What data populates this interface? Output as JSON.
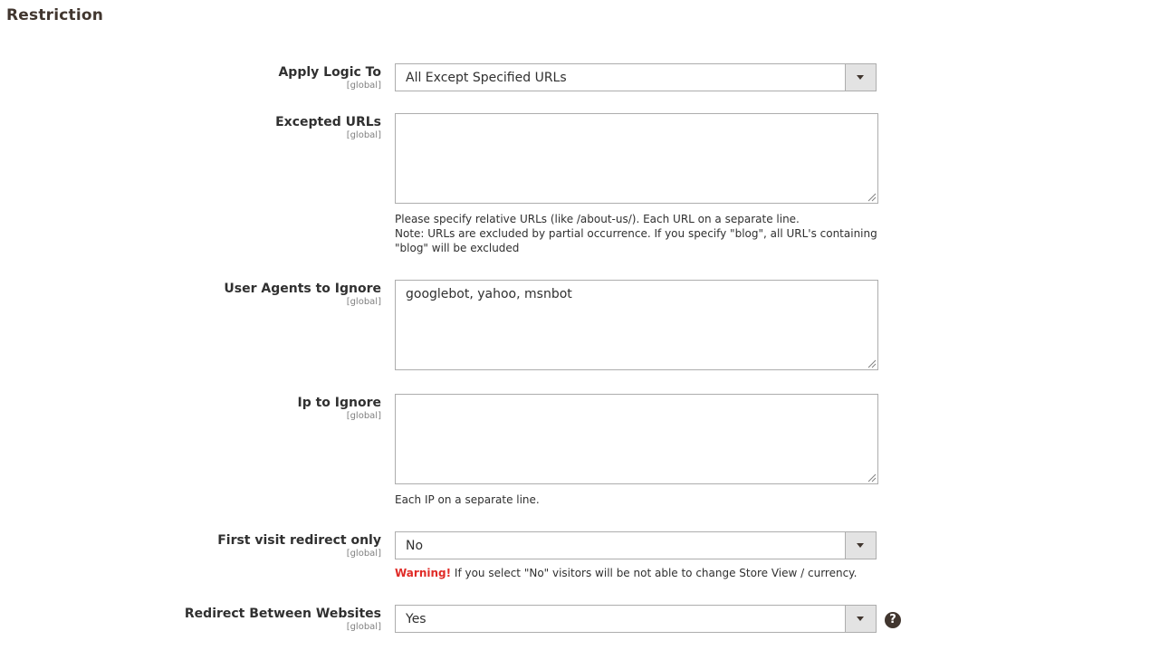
{
  "section": {
    "title": "Restriction"
  },
  "fields": {
    "apply_logic": {
      "label": "Apply Logic To",
      "scope": "[global]",
      "value": "All Except Specified URLs"
    },
    "excepted_urls": {
      "label": "Excepted URLs",
      "scope": "[global]",
      "value": "",
      "note_line1": "Please specify relative URLs (like /about-us/). Each URL on a separate line.",
      "note_line2": "Note: URLs are excluded by partial occurrence. If you specify \"blog\", all URL's containing \"blog\" will be excluded"
    },
    "user_agents": {
      "label": "User Agents to Ignore",
      "scope": "[global]",
      "value": "googlebot, yahoo, msnbot"
    },
    "ip_ignore": {
      "label": "Ip to Ignore",
      "scope": "[global]",
      "value": "",
      "note": "Each IP on a separate line."
    },
    "first_visit": {
      "label": "First visit redirect only",
      "scope": "[global]",
      "value": "No",
      "warning_label": "Warning!",
      "warning_text": " If you select \"No\" visitors will be not able to change Store View / currency."
    },
    "redirect_websites": {
      "label": "Redirect Between Websites",
      "scope": "[global]",
      "value": "Yes",
      "help_glyph": "?"
    }
  },
  "colors": {
    "text": "#303030",
    "title": "#41362f",
    "scope": "#808080",
    "border": "#adadad",
    "arrow_bg": "#e3e3e3",
    "warning": "#e02b27"
  }
}
